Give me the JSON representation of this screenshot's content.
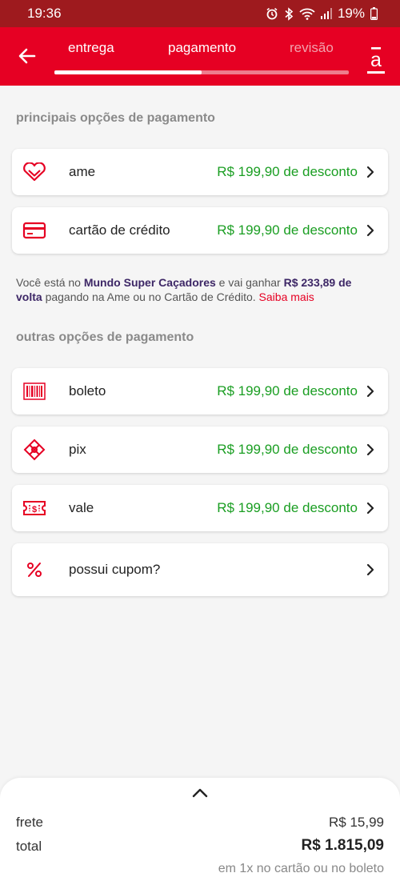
{
  "status_bar": {
    "time": "19:36",
    "battery": "19%"
  },
  "header": {
    "tabs": [
      {
        "label": "entrega",
        "state": "done"
      },
      {
        "label": "pagamento",
        "state": "active"
      },
      {
        "label": "revisão",
        "state": "disabled"
      }
    ],
    "progress": 0.5,
    "logo": "a"
  },
  "main_section": {
    "title": "principais opções de pagamento",
    "items": [
      {
        "icon": "ame-heart-icon",
        "label": "ame",
        "discount": "R$ 199,90 de desconto"
      },
      {
        "icon": "credit-card-icon",
        "label": "cartão de crédito",
        "discount": "R$ 199,90 de desconto"
      }
    ]
  },
  "promo": {
    "p1": "Você está no ",
    "store": "Mundo Super Caçadores",
    "p2": " e vai ganhar ",
    "cashback": "R$ 233,89 de volta",
    "p3": " pagando na Ame ou no Cartão de Crédito. ",
    "link": "Saiba mais"
  },
  "other_section": {
    "title": "outras opções de pagamento",
    "items": [
      {
        "icon": "barcode-icon",
        "label": "boleto",
        "discount": "R$ 199,90 de desconto"
      },
      {
        "icon": "pix-icon",
        "label": "pix",
        "discount": "R$ 199,90 de desconto"
      },
      {
        "icon": "voucher-icon",
        "label": "vale",
        "discount": "R$ 199,90 de desconto"
      },
      {
        "icon": "percent-icon",
        "label": "possui cupom?"
      }
    ]
  },
  "summary": {
    "shipping_label": "frete",
    "shipping_value": "R$ 15,99",
    "total_label": "total",
    "total_value": "R$ 1.815,09",
    "note": "em 1x no cartão ou no boleto"
  },
  "colors": {
    "brand_red": "#e60023",
    "status_bar": "#9e1a1e",
    "discount_green": "#1a9e22",
    "promo_purple": "#3d2766"
  }
}
